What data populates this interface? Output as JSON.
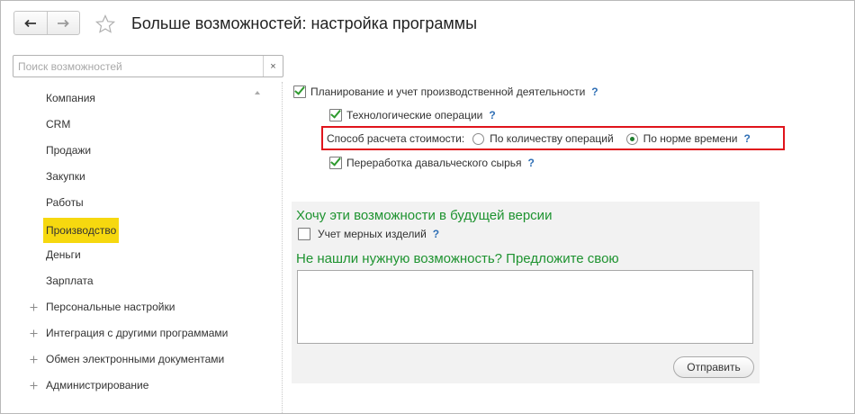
{
  "window": {
    "title": "Больше возможностей: настройка программы"
  },
  "search": {
    "placeholder": "Поиск возможностей",
    "clear_glyph": "×"
  },
  "sidebar": {
    "items": [
      {
        "label": "Компания"
      },
      {
        "label": "CRM"
      },
      {
        "label": "Продажи"
      },
      {
        "label": "Закупки"
      },
      {
        "label": "Работы"
      },
      {
        "label": "Производство",
        "active": true
      },
      {
        "label": "Деньги"
      },
      {
        "label": "Зарплата"
      },
      {
        "label": "Персональные настройки",
        "expandable": true
      },
      {
        "label": "Интеграция с другими программами",
        "expandable": true
      },
      {
        "label": "Обмен электронными документами",
        "expandable": true
      },
      {
        "label": "Администрирование",
        "expandable": true
      }
    ]
  },
  "settings": {
    "production_planning": {
      "label": "Планирование и учет производственной деятельности",
      "checked": true,
      "help": "?"
    },
    "tech_operations": {
      "label": "Технологические операции",
      "checked": true,
      "help": "?"
    },
    "cost_method": {
      "label": "Способ расчета стоимости:",
      "options": [
        {
          "label": "По количеству операций",
          "selected": false
        },
        {
          "label": "По норме времени",
          "selected": true
        }
      ],
      "help": "?"
    },
    "tolling": {
      "label": "Переработка давальческого сырья",
      "checked": true,
      "help": "?"
    }
  },
  "future": {
    "heading": "Хочу эти возможности в будущей версии",
    "measured_items": {
      "label": "Учет мерных изделий",
      "checked": false,
      "help": "?"
    },
    "suggest_heading": "Не нашли нужную возможность? Предложите свою",
    "send_label": "Отправить"
  },
  "colors": {
    "active_item": "#f6d80f",
    "heading_green": "#1e9330",
    "highlight_red": "#e0141c",
    "help_blue": "#2f6fb5"
  }
}
